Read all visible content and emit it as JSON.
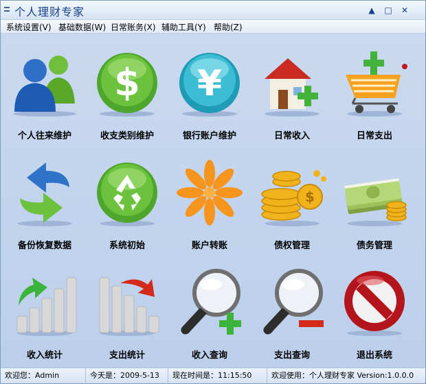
{
  "window": {
    "title": "个人理财专家",
    "controls": {
      "minimize": "▲",
      "maximize": "□",
      "close": "✕"
    }
  },
  "menu": [
    {
      "label": "系统设置(V)"
    },
    {
      "label": "基础数据(W)"
    },
    {
      "label": "日常账务(X)"
    },
    {
      "label": "辅助工具(Y)"
    },
    {
      "label": "帮助(Z)"
    }
  ],
  "tiles": [
    {
      "label": "个人往来维护",
      "icon": "contacts-icon"
    },
    {
      "label": "收支类别维护",
      "icon": "dollar-icon"
    },
    {
      "label": "银行账户维护",
      "icon": "yen-icon"
    },
    {
      "label": "日常收入",
      "icon": "house-add-icon"
    },
    {
      "label": "日常支出",
      "icon": "cart-add-icon"
    },
    {
      "label": "备份恢复数据",
      "icon": "backup-arrows-icon"
    },
    {
      "label": "系统初始",
      "icon": "recycle-icon"
    },
    {
      "label": "账户转账",
      "icon": "transfer-flower-icon"
    },
    {
      "label": "债权管理",
      "icon": "coins-icon"
    },
    {
      "label": "债务管理",
      "icon": "cash-stack-icon"
    },
    {
      "label": "收入统计",
      "icon": "bar-up-icon"
    },
    {
      "label": "支出统计",
      "icon": "bar-down-icon"
    },
    {
      "label": "收入查询",
      "icon": "search-plus-icon"
    },
    {
      "label": "支出查询",
      "icon": "search-minus-icon"
    },
    {
      "label": "退出系统",
      "icon": "no-entry-icon"
    }
  ],
  "status": {
    "user": "欢迎您：Admin",
    "date": "今天是：2009-5-13",
    "time": "现在时间是：11:15:50",
    "version": "欢迎使用：个人理财专家 Version:1.0.0.0"
  },
  "colors": {
    "accent": "#15428b",
    "background": "#c9d9ef",
    "green": "#3cb43c",
    "orange": "#f7941d",
    "red": "#c0171d"
  }
}
